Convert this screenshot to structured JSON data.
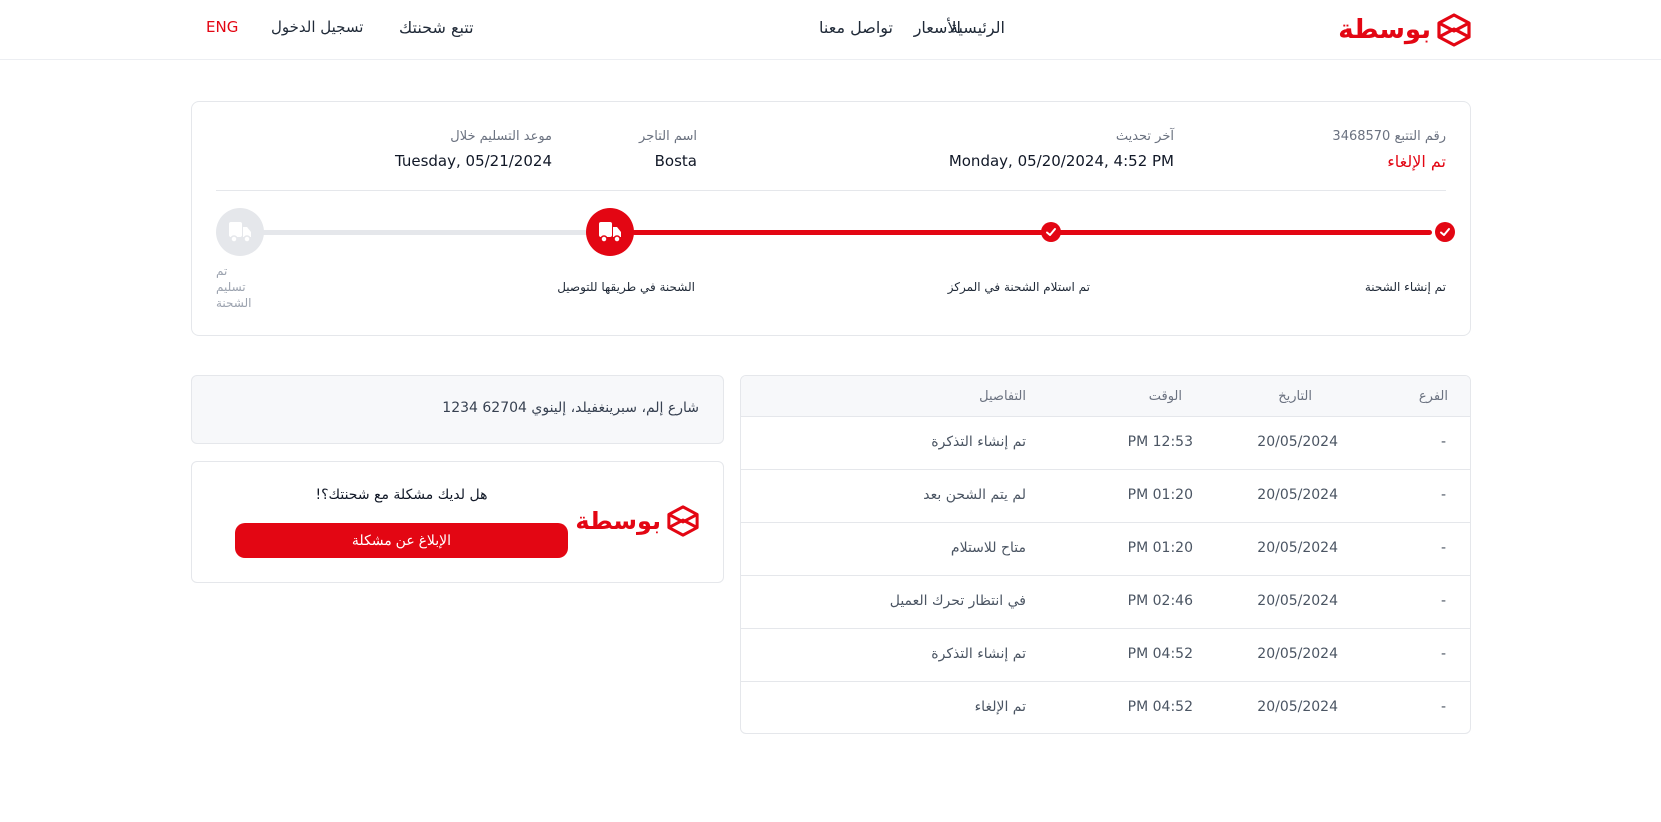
{
  "header": {
    "logo_text": "بوسطة",
    "nav": {
      "home": "الرئيسية",
      "pricing": "الأسعار",
      "contact": "تواصل معنا",
      "track": "تتبع شحنتك",
      "login": "تسجيل الدخول",
      "lang": "ENG"
    }
  },
  "shipment": {
    "tracking_label": "رقم التتبع 3468570",
    "status": "تم الإلغاء",
    "last_update_label": "آخر تحديث",
    "last_update_value": "Monday, 05/20/2024, 4:52 PM",
    "merchant_label": "اسم التاجر",
    "merchant_value": "Bosta",
    "delivery_label": "موعد التسليم خلال",
    "delivery_value": "Tuesday, 05/21/2024"
  },
  "progress": {
    "steps": [
      {
        "label": "تم إنشاء الشحنة",
        "state": "done"
      },
      {
        "label": "تم استلام الشحنة في المركز",
        "state": "done"
      },
      {
        "label": "الشحنة في طريقها للتوصيل",
        "state": "current"
      },
      {
        "label": "تم تسليم الشحنة",
        "label_lines": [
          "تم",
          "تسليم",
          "الشحنة"
        ],
        "state": "pending"
      }
    ]
  },
  "events": {
    "headers": {
      "branch": "الفرع",
      "date": "التاريخ",
      "time": "الوقت",
      "details": "التفاصيل"
    },
    "rows": [
      {
        "branch": "-",
        "date": "20/05/2024",
        "time": "PM 12:53",
        "details": "تم إنشاء التذكرة"
      },
      {
        "branch": "-",
        "date": "20/05/2024",
        "time": "PM 01:20",
        "details": "لم يتم الشحن بعد"
      },
      {
        "branch": "-",
        "date": "20/05/2024",
        "time": "PM 01:20",
        "details": "متاح للاستلام"
      },
      {
        "branch": "-",
        "date": "20/05/2024",
        "time": "PM 02:46",
        "details": "في انتظار تحرك العميل"
      },
      {
        "branch": "-",
        "date": "20/05/2024",
        "time": "PM 04:52",
        "details": "تم إنشاء التذكرة"
      },
      {
        "branch": "-",
        "date": "20/05/2024",
        "time": "PM 04:52",
        "details": "تم الإلغاء"
      }
    ]
  },
  "address": "1234 شارع إلم، سبرينغفيلد، إلينوي 62704",
  "problem": {
    "question": "!هل لديك مشكلة مع شحنتك؟",
    "button": "الإبلاغ عن مشكلة",
    "logo_text": "بوسطة"
  },
  "colors": {
    "brand": "#e30613",
    "border": "#e5e7eb",
    "muted": "#6b7280"
  }
}
